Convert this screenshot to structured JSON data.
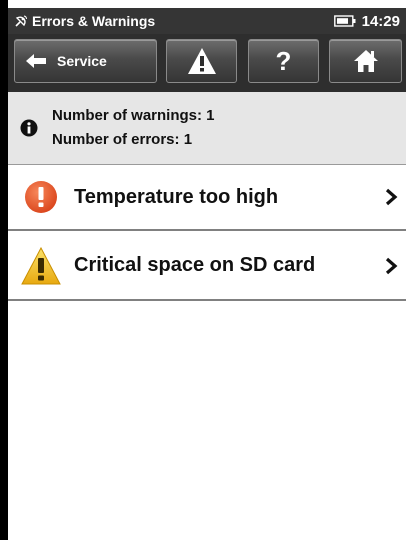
{
  "statusbar": {
    "title": "Errors & Warnings",
    "time": "14:29",
    "app_icon": "satellite-dish-icon",
    "battery_icon": "battery-icon"
  },
  "toolbar": {
    "back_label": "Service",
    "back_icon": "arrow-left-icon",
    "warning_icon": "warning-triangle-icon",
    "help_label": "?",
    "home_icon": "home-icon"
  },
  "summary": {
    "icon": "info-icon",
    "warnings_text": "Number of warnings: 1",
    "errors_text": "Number of errors: 1"
  },
  "items": [
    {
      "label": "Temperature too high",
      "icon": "error-exclamation-icon",
      "icon_color": "#e8531e"
    },
    {
      "label": "Critical space on SD card",
      "icon": "warning-triangle-icon",
      "icon_color": "#f2c21b"
    }
  ],
  "colors": {
    "statusbar_bg": "#353535",
    "toolbar_bg": "#2e2e2e",
    "summary_bg": "#e6e6e6"
  }
}
